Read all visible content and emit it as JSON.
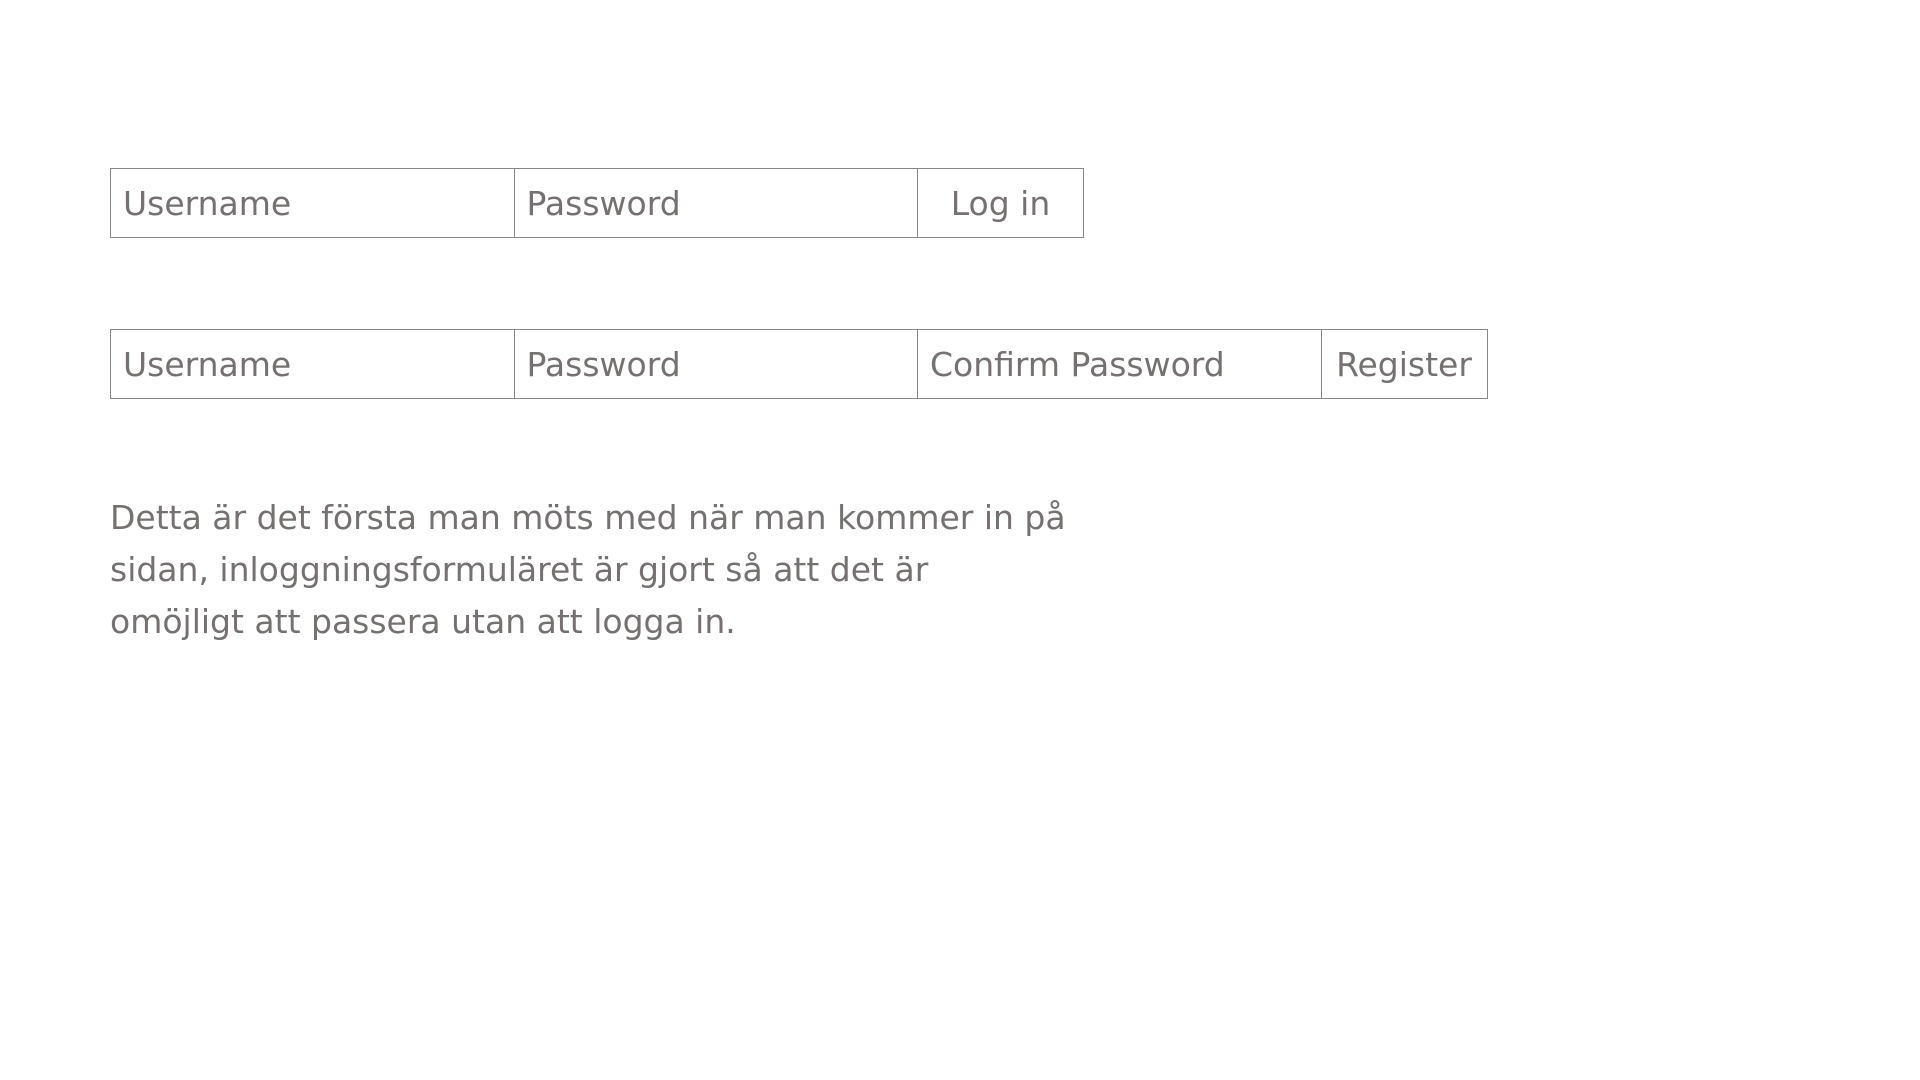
{
  "login_form": {
    "username_placeholder": "Username",
    "password_placeholder": "Password",
    "submit_label": "Log in"
  },
  "register_form": {
    "username_placeholder": "Username",
    "password_placeholder": "Password",
    "confirm_password_placeholder": "Confirm Password",
    "submit_label": "Register"
  },
  "description": "Detta är det första man möts med när man kommer in på sidan, inloggningsformuläret är gjort så att det är omöjligt att passera utan att logga in.",
  "colors": {
    "text": "#767171",
    "border": "#8a8686",
    "background": "#ffffff"
  }
}
